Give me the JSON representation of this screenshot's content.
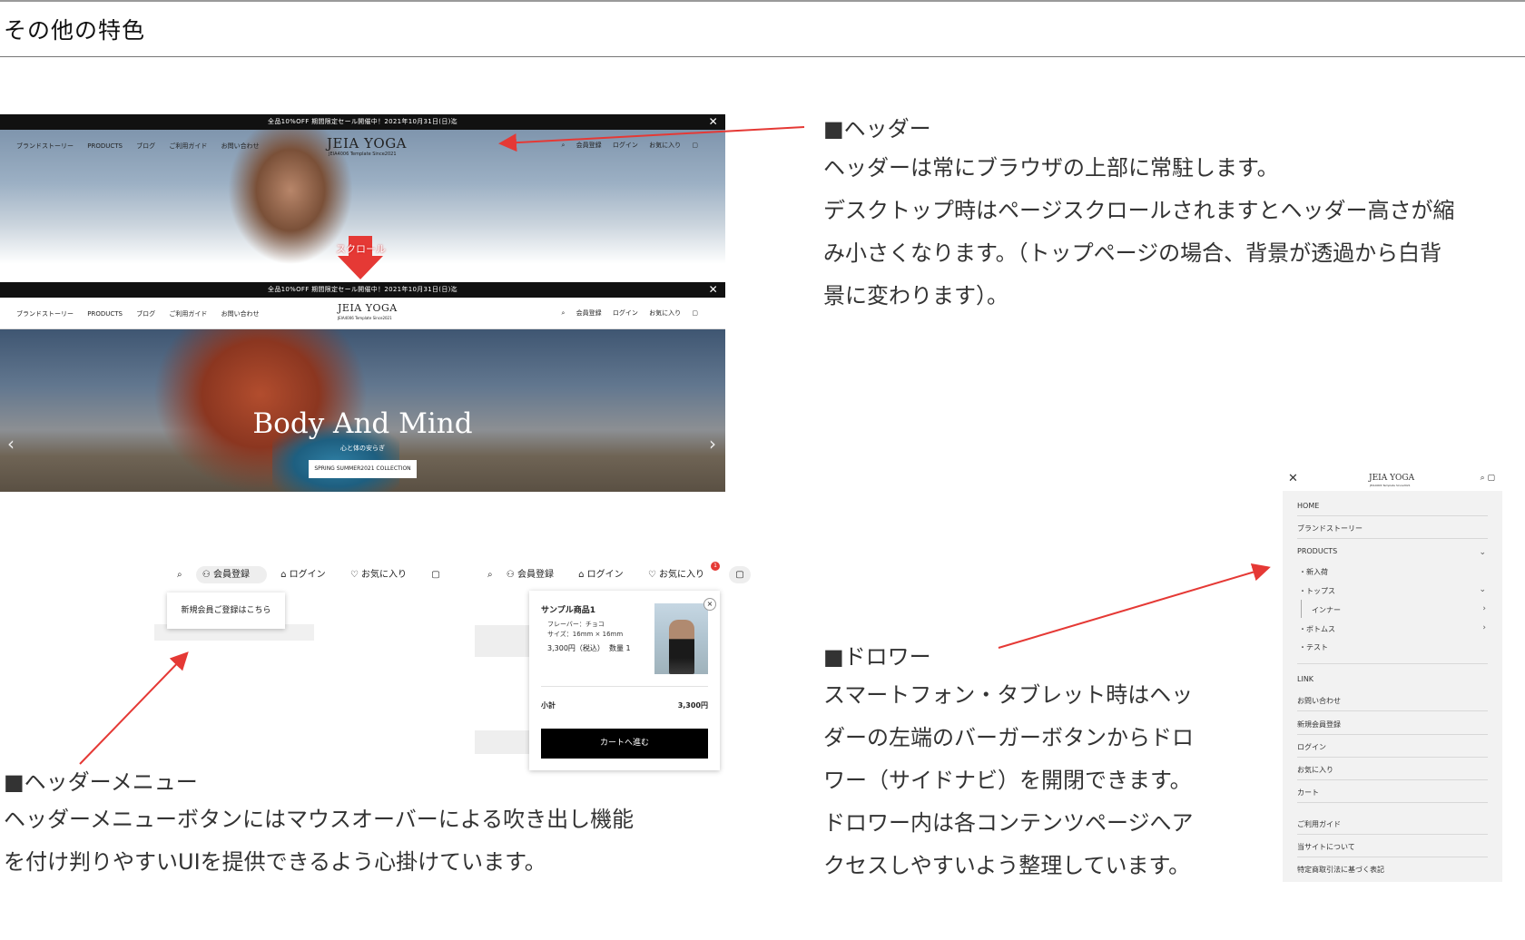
{
  "page": {
    "title": "その他の特色"
  },
  "shot_hero": {
    "announcement": "全品10%OFF 期間限定セール開催中！2021年10月31日(日)迄",
    "nav_links": [
      "ブランドストーリー",
      "PRODUCTS",
      "ブログ",
      "ご利用ガイド",
      "お問い合わせ"
    ],
    "logo": "JEIA YOGA",
    "logo_sub": "JEIA4006 Template Since2021",
    "icons": [
      "🔍︎",
      "会員登録",
      "ログイン",
      "お気に入り",
      "🛍"
    ],
    "scroll_label": "スクロール",
    "hero_title": "Body And Mind",
    "hero_subtitle": "心と体の安らぎ",
    "hero_cta": "SPRING SUMMER2021 COLLECTION"
  },
  "header_menu": {
    "row1": [
      "会員登録",
      "ログイン",
      "お気に入り"
    ],
    "tooltip": "新規会員ご登録はこちら",
    "cart": {
      "name": "サンプル商品1",
      "flavor": "フレーバー：チョコ",
      "size": "サイズ：16mm × 16mm",
      "price": "3,300円（税込）",
      "qty": "数量 1",
      "subtotal_label": "小計",
      "subtotal": "3,300円",
      "checkout": "カートへ進む",
      "badge": "1"
    }
  },
  "header_desc": {
    "heading": "■ヘッダー",
    "lines": [
      "ヘッダーは常にブラウザの上部に常駐します。",
      "デスクトップ時はページスクロールされますとヘッダー高さが縮",
      "み小さくなります。（トップページの場合、背景が透過から白背",
      "景に変わります）。"
    ]
  },
  "menu_desc": {
    "heading": "■ヘッダーメニュー",
    "lines": [
      "ヘッダーメニューボタンにはマウスオーバーによる吹き出し機能",
      "を付け判りやすいUIを提供できるよう心掛けています。"
    ]
  },
  "drawer_desc": {
    "heading": "■ドロワー",
    "lines": [
      "スマートフォン・タブレット時はヘッ",
      "ダーの左端のバーガーボタンからドロ",
      "ワー（サイドナビ）を開閉できます。",
      "ドロワー内は各コンテンツページへア",
      "クセスしやすいよう整理しています。"
    ]
  },
  "drawer": {
    "logo": "JEIA YOGA",
    "logo_sub": "JEIA4006 Template Since2021",
    "home": "HOME",
    "brand": "ブランドストーリー",
    "products": "PRODUCTS",
    "new": "・新入荷",
    "tops": "・トップス",
    "inner": "インナー",
    "bottoms": "・ボトムス",
    "test": "・テスト",
    "link": "LINK",
    "contact": "お問い合わせ",
    "register": "新規会員登録",
    "login": "ログイン",
    "favorite": "お気に入り",
    "cart": "カート",
    "guide": "ご利用ガイド",
    "about": "当サイトについて",
    "law": "特定商取引法に基づく表記"
  },
  "colors": {
    "accent_arrow": "#e53935"
  }
}
